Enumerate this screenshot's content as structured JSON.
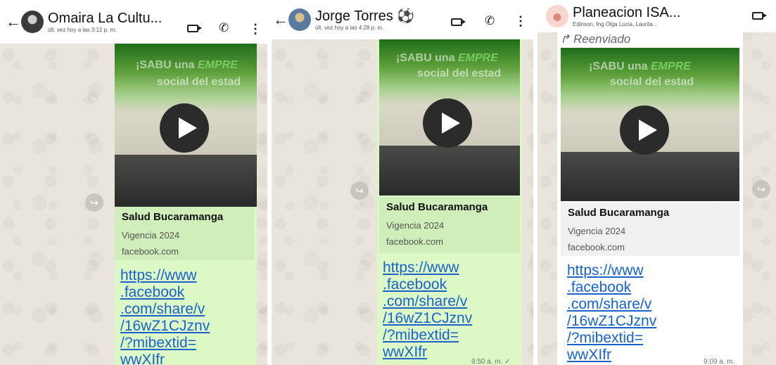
{
  "panels": [
    {
      "contact": {
        "name": "Omaira La Cultu...",
        "status": "últ. vez hoy a las 3:12 p. m."
      },
      "message": {
        "overlay_main": "¡SABU una ",
        "overlay_accent": "EMPRE",
        "overlay_sub": "social del estad",
        "card_title": "Salud Bucaramanga",
        "card_desc": "Vigencia 2024",
        "card_domain": "facebook.com",
        "link": "https://www\n.facebook\n.com/share/v\n/16wZ1CJznv\n/?mibextid=\nwwXIfr",
        "time": ""
      }
    },
    {
      "contact": {
        "name": "Jorge Torres ⚽",
        "status": "últ. vez hoy a las 4:28 p. m."
      },
      "message": {
        "overlay_main": "¡SABU una ",
        "overlay_accent": "EMPRE",
        "overlay_sub": "social del estad",
        "card_title": "Salud Bucaramanga",
        "card_desc": "Vigencia 2024",
        "card_domain": "facebook.com",
        "link": "https://www\n.facebook\n.com/share/v\n/16wZ1CJznv\n/?mibextid=\nwwXIfr",
        "time": "9:50 a. m. ✓"
      }
    },
    {
      "contact": {
        "name": "Planeacion ISA...",
        "status": "Edinson, Ing Olga Lucia, Laurita..."
      },
      "message": {
        "forwarded_label": "Reenviado",
        "overlay_main": "¡SABU una ",
        "overlay_accent": "EMPRE",
        "overlay_sub": "social del estad",
        "card_title": "Salud Bucaramanga",
        "card_desc": "Vigencia 2024",
        "card_domain": "facebook.com",
        "link": "https://www\n.facebook\n.com/share/v\n/16wZ1CJznv\n/?mibextid=\nwwXIfr",
        "time": "9:09 a. m."
      }
    }
  ],
  "icons": {
    "back": "←",
    "video": "video-call-icon",
    "call": "phone-icon",
    "menu": "⋮",
    "forward": "↪"
  },
  "colors": {
    "bubble": "#dcf8c6",
    "card": "#cfeeb9",
    "link": "#1a63c9",
    "wallpaper": "#e9e4dc"
  }
}
